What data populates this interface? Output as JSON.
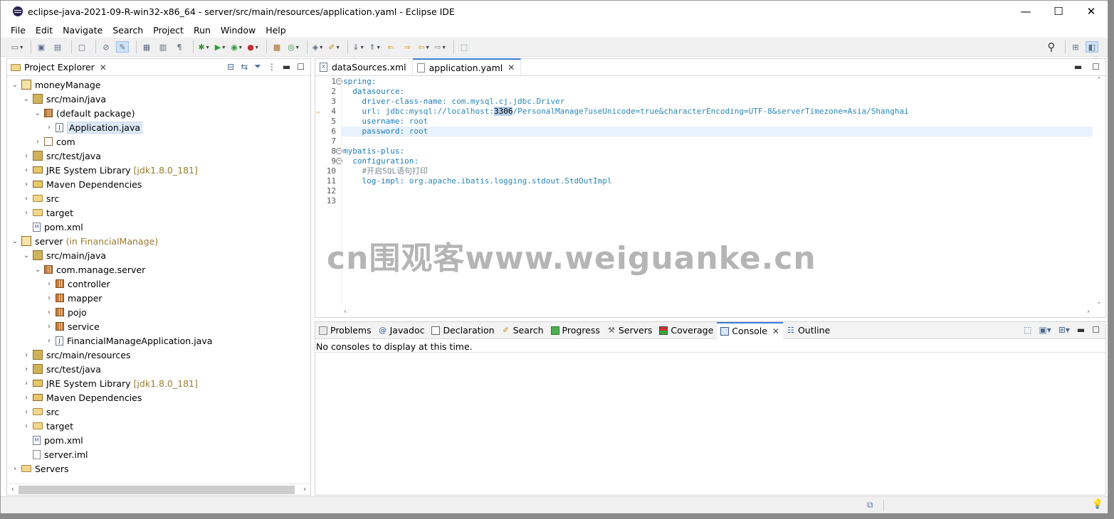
{
  "window": {
    "title": "eclipse-java-2021-09-R-win32-x86_64 - server/src/main/resources/application.yaml - Eclipse IDE",
    "minimize": "—",
    "maximize": "☐",
    "close": "✕"
  },
  "menu": [
    "File",
    "Edit",
    "Navigate",
    "Search",
    "Project",
    "Run",
    "Window",
    "Help"
  ],
  "explorer": {
    "title": "Project Explorer",
    "tree": [
      {
        "label": "moneyManage",
        "deco": "",
        "icon": "project-icon",
        "indent": 0,
        "twisty": "v"
      },
      {
        "label": "src/main/java",
        "deco": "",
        "icon": "source-folder-icon",
        "indent": 1,
        "twisty": "v"
      },
      {
        "label": "(default package)",
        "deco": "",
        "icon": "package-icon",
        "indent": 2,
        "twisty": "v"
      },
      {
        "label": "Application.java",
        "deco": "",
        "icon": "java-file-icon",
        "indent": 3,
        "twisty": ">",
        "selected": true
      },
      {
        "label": "com",
        "deco": "",
        "icon": "empty-package-icon",
        "indent": 2,
        "twisty": ">"
      },
      {
        "label": "src/test/java",
        "deco": "",
        "icon": "source-folder-icon",
        "indent": 1,
        "twisty": ">"
      },
      {
        "label": "JRE System Library",
        "deco": "[jdk1.8.0_181]",
        "icon": "library-icon",
        "indent": 1,
        "twisty": ">"
      },
      {
        "label": "Maven Dependencies",
        "deco": "",
        "icon": "library-icon",
        "indent": 1,
        "twisty": ">"
      },
      {
        "label": "src",
        "deco": "",
        "icon": "folder-icon",
        "indent": 1,
        "twisty": ">"
      },
      {
        "label": "target",
        "deco": "",
        "icon": "folder-icon",
        "indent": 1,
        "twisty": ">"
      },
      {
        "label": "pom.xml",
        "deco": "",
        "icon": "xml-file-icon",
        "indent": 1,
        "twisty": ""
      },
      {
        "label": "server",
        "deco": "(in FinancialManage)",
        "icon": "project-icon",
        "indent": 0,
        "twisty": "v"
      },
      {
        "label": "src/main/java",
        "deco": "",
        "icon": "source-folder-icon",
        "indent": 1,
        "twisty": "v"
      },
      {
        "label": "com.manage.server",
        "deco": "",
        "icon": "package-icon",
        "indent": 2,
        "twisty": "v"
      },
      {
        "label": "controller",
        "deco": "",
        "icon": "package-icon",
        "indent": 3,
        "twisty": ">"
      },
      {
        "label": "mapper",
        "deco": "",
        "icon": "package-icon",
        "indent": 3,
        "twisty": ">"
      },
      {
        "label": "pojo",
        "deco": "",
        "icon": "package-icon",
        "indent": 3,
        "twisty": ">"
      },
      {
        "label": "service",
        "deco": "",
        "icon": "package-icon",
        "indent": 3,
        "twisty": ">"
      },
      {
        "label": "FinancialManageApplication.java",
        "deco": "",
        "icon": "java-file-icon",
        "indent": 3,
        "twisty": ">"
      },
      {
        "label": "src/main/resources",
        "deco": "",
        "icon": "source-folder-icon",
        "indent": 1,
        "twisty": ">"
      },
      {
        "label": "src/test/java",
        "deco": "",
        "icon": "source-folder-icon",
        "indent": 1,
        "twisty": ">"
      },
      {
        "label": "JRE System Library",
        "deco": "[jdk1.8.0_181]",
        "icon": "library-icon",
        "indent": 1,
        "twisty": ">"
      },
      {
        "label": "Maven Dependencies",
        "deco": "",
        "icon": "library-icon",
        "indent": 1,
        "twisty": ">"
      },
      {
        "label": "src",
        "deco": "",
        "icon": "folder-icon",
        "indent": 1,
        "twisty": ">"
      },
      {
        "label": "target",
        "deco": "",
        "icon": "folder-icon",
        "indent": 1,
        "twisty": ">"
      },
      {
        "label": "pom.xml",
        "deco": "",
        "icon": "xml-file-icon",
        "indent": 1,
        "twisty": ""
      },
      {
        "label": "server.iml",
        "deco": "",
        "icon": "file-icon",
        "indent": 1,
        "twisty": ""
      },
      {
        "label": "Servers",
        "deco": "",
        "icon": "servers-folder-icon",
        "indent": 0,
        "twisty": ">"
      }
    ]
  },
  "editor": {
    "tabs": [
      {
        "label": "dataSources.xml",
        "active": false
      },
      {
        "label": "application.yaml",
        "active": true
      }
    ],
    "lines": [
      {
        "num": "1",
        "fold": true,
        "parts": [
          [
            "k",
            "spring:"
          ]
        ]
      },
      {
        "num": "2",
        "parts": [
          [
            "",
            "  "
          ],
          [
            "k",
            "datasource:"
          ]
        ]
      },
      {
        "num": "3",
        "parts": [
          [
            "",
            "    "
          ],
          [
            "k",
            "driver-class-name:"
          ],
          [
            "",
            " "
          ],
          [
            "v",
            "com.mysql.cj.jdbc.Driver"
          ]
        ]
      },
      {
        "num": "4",
        "marker": true,
        "parts": [
          [
            "",
            "    "
          ],
          [
            "k",
            "url:"
          ],
          [
            "",
            " "
          ],
          [
            "v",
            "jdbc:mysql://localhost:"
          ],
          [
            "hl",
            "3306"
          ],
          [
            "v",
            "/PersonalManage?useUnicode=true&characterEncoding=UTF-8&serverTimezone=Asia/Shanghai"
          ]
        ]
      },
      {
        "num": "5",
        "parts": [
          [
            "",
            "    "
          ],
          [
            "k",
            "username:"
          ],
          [
            "",
            " "
          ],
          [
            "v",
            "root"
          ]
        ]
      },
      {
        "num": "6",
        "current": true,
        "parts": [
          [
            "",
            "    "
          ],
          [
            "k",
            "password:"
          ],
          [
            "",
            " "
          ],
          [
            "v",
            "root"
          ]
        ]
      },
      {
        "num": "7",
        "parts": []
      },
      {
        "num": "8",
        "fold": true,
        "parts": [
          [
            "k",
            "mybatis-plus:"
          ]
        ]
      },
      {
        "num": "9",
        "fold": true,
        "parts": [
          [
            "",
            "  "
          ],
          [
            "k",
            "configuration:"
          ]
        ]
      },
      {
        "num": "10",
        "parts": [
          [
            "",
            "    "
          ],
          [
            "c",
            "#开启SQL语句打印"
          ]
        ]
      },
      {
        "num": "11",
        "parts": [
          [
            "",
            "    "
          ],
          [
            "k",
            "log-impl:"
          ],
          [
            "",
            " "
          ],
          [
            "v",
            "org.apache.ibatis.logging.stdout.StdOutImpl"
          ]
        ]
      },
      {
        "num": "12",
        "parts": []
      },
      {
        "num": "13",
        "parts": []
      }
    ]
  },
  "watermark": "cn围观客www.weiguanke.cn",
  "console": {
    "tabs": [
      "Problems",
      "Javadoc",
      "Declaration",
      "Search",
      "Progress",
      "Servers",
      "Coverage",
      "Console",
      "Outline"
    ],
    "active_tab": "Console",
    "message": "No consoles to display at this time."
  },
  "colors": {
    "yaml_key": "#1e7bb8",
    "yaml_value": "#2a86b8",
    "comment": "#7f8c8d",
    "active_tab_accent": "#3b7bd6",
    "deco": "#9a7b30"
  }
}
